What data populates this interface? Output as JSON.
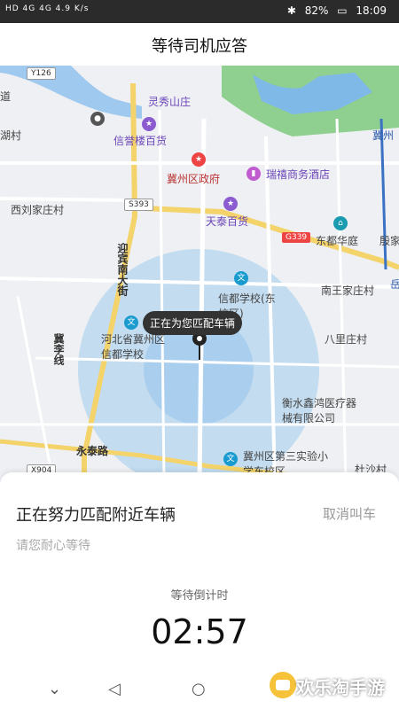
{
  "status": {
    "left": "HD 4G 4G 4.9 K/s",
    "battery": "82%",
    "time": "18:09"
  },
  "header": {
    "title": "等待司机应答"
  },
  "map": {
    "labels": {
      "y126": "Y126",
      "lingxiu": "灵秀山庄",
      "xinyulou": "信誉楼百货",
      "jizhou_gov": "冀州区政府",
      "ruixi": "瑞禧商务酒店",
      "xiliu": "西刘家庄村",
      "s393": "S393",
      "tiantai": "天泰百货",
      "g339": "G339",
      "dongdu": "东都华庭",
      "yingbin": "迎宾南大街",
      "xindu_school": "信都学校(东校区)",
      "nanwang": "南王家庄村",
      "hebei_school": "河北省冀州区信都学校",
      "jili": "冀李线",
      "balizhuang": "八里庄村",
      "hengshui": "衡水鑫鸿医疗器械有限公司",
      "yongtai": "永泰路",
      "jizhou3": "冀州区第三实验小学东校区",
      "x904": "X904",
      "dushacun": "杜沙村",
      "dao": "道",
      "hu": "湖村",
      "ji_edge": "冀州",
      "yue": "岳",
      "duan": "殷家"
    },
    "bubble": "正在为您匹配车辆"
  },
  "sheet": {
    "main_text": "正在努力匹配附近车辆",
    "cancel_label": "取消叫车",
    "sub_text": "请您耐心等待",
    "countdown_label": "等待倒计时",
    "countdown": "02:57"
  },
  "watermark": {
    "text": "欢乐淘手游"
  }
}
